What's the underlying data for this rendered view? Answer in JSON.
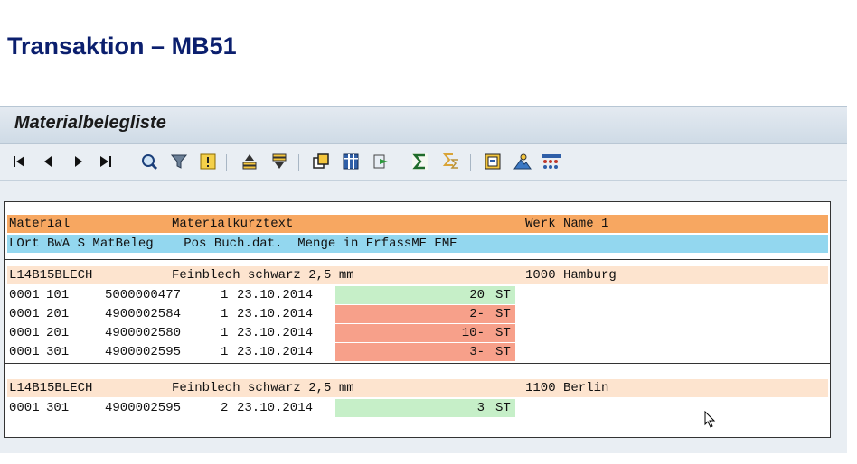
{
  "slide": {
    "title": "Transaktion – MB51"
  },
  "screen": {
    "title": "Materialbelegliste"
  },
  "toolbar": {
    "buttons": [
      {
        "icon": "first-page-icon"
      },
      {
        "icon": "previous-page-icon"
      },
      {
        "icon": "next-page-icon"
      },
      {
        "icon": "last-page-icon"
      },
      {
        "icon": "details-icon"
      },
      {
        "icon": "filter-icon"
      },
      {
        "icon": "exception-icon"
      },
      {
        "icon": "sort-ascending-icon"
      },
      {
        "icon": "sort-descending-icon"
      },
      {
        "icon": "select-layout-icon"
      },
      {
        "icon": "columns-icon"
      },
      {
        "icon": "export-icon"
      },
      {
        "icon": "sum-icon"
      },
      {
        "icon": "subtotal-icon"
      },
      {
        "icon": "save-layout-icon"
      },
      {
        "icon": "display-graphic-icon"
      },
      {
        "icon": "layout-matrix-icon"
      }
    ]
  },
  "header": {
    "row1": {
      "material": "Material",
      "text": "Materialkurztext",
      "plant": "Werk Name 1"
    },
    "row2": {
      "text": "LOrt BwA S MatBeleg    Pos Buch.dat.  Menge in ErfassME EME"
    }
  },
  "groups": [
    {
      "material": "L14B15BLECH",
      "text": "Feinblech schwarz 2,5 mm",
      "plant": "1000 Hamburg",
      "items": [
        {
          "sloc": "0001",
          "mvt": "101",
          "doc": "5000000477",
          "pos": "1",
          "date": "23.10.2014",
          "qty": "20",
          "uom": "ST",
          "sign": "pos"
        },
        {
          "sloc": "0001",
          "mvt": "201",
          "doc": "4900002584",
          "pos": "1",
          "date": "23.10.2014",
          "qty": "2-",
          "uom": "ST",
          "sign": "neg"
        },
        {
          "sloc": "0001",
          "mvt": "201",
          "doc": "4900002580",
          "pos": "1",
          "date": "23.10.2014",
          "qty": "10-",
          "uom": "ST",
          "sign": "neg"
        },
        {
          "sloc": "0001",
          "mvt": "301",
          "doc": "4900002595",
          "pos": "1",
          "date": "23.10.2014",
          "qty": "3-",
          "uom": "ST",
          "sign": "neg"
        }
      ]
    },
    {
      "material": "L14B15BLECH",
      "text": "Feinblech schwarz 2,5 mm",
      "plant": "1100 Berlin",
      "items": [
        {
          "sloc": "0001",
          "mvt": "301",
          "doc": "4900002595",
          "pos": "2",
          "date": "23.10.2014",
          "qty": "3",
          "uom": "ST",
          "sign": "pos"
        }
      ]
    }
  ],
  "colors": {
    "header1": "#f7a761",
    "header2": "#93d7ef",
    "group": "#fde4cf",
    "positive": "#c6efc8",
    "negative": "#f7a08a"
  }
}
